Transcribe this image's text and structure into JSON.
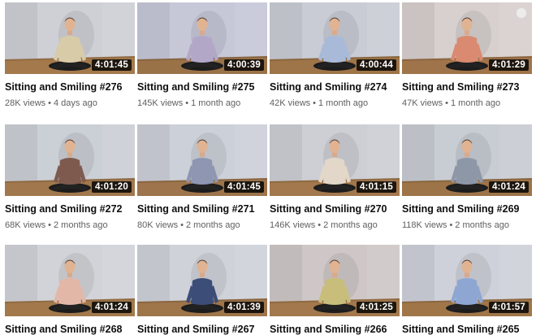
{
  "videos": [
    {
      "title": "Sitting and Smiling #276",
      "views": "28K views",
      "age": "4 days ago",
      "duration": "4:01:45",
      "shirt": "#d8cba8",
      "bg": "#cfd0d6",
      "floor": "#a47a4c"
    },
    {
      "title": "Sitting and Smiling #275",
      "views": "145K views",
      "age": "1 month ago",
      "duration": "4:00:39",
      "shirt": "#b3a7c8",
      "bg": "#c6c8d8",
      "floor": "#9a7248"
    },
    {
      "title": "Sitting and Smiling #274",
      "views": "42K views",
      "age": "1 month ago",
      "duration": "4:00:44",
      "shirt": "#a9bad8",
      "bg": "#c9ccd4",
      "floor": "#9e7548"
    },
    {
      "title": "Sitting and Smiling #273",
      "views": "47K views",
      "age": "1 month ago",
      "duration": "4:01:29",
      "shirt": "#d98a70",
      "bg": "#d7d0cf",
      "floor": "#a0744a"
    },
    {
      "title": "Sitting and Smiling #272",
      "views": "68K views",
      "age": "2 months ago",
      "duration": "4:01:20",
      "shirt": "#7e5a4e",
      "bg": "#cbcfd6",
      "floor": "#a1784d"
    },
    {
      "title": "Sitting and Smiling #271",
      "views": "80K views",
      "age": "2 months ago",
      "duration": "4:01:45",
      "shirt": "#8e96b2",
      "bg": "#ccd0d8",
      "floor": "#9d744b"
    },
    {
      "title": "Sitting and Smiling #270",
      "views": "146K views",
      "age": "2 months ago",
      "duration": "4:01:15",
      "shirt": "#e2d7c8",
      "bg": "#cdcfd5",
      "floor": "#a2784c"
    },
    {
      "title": "Sitting and Smiling #269",
      "views": "118K views",
      "age": "2 months ago",
      "duration": "4:01:24",
      "shirt": "#8d97a8",
      "bg": "#c8ccd3",
      "floor": "#9d7448"
    },
    {
      "title": "Sitting and Smiling #268",
      "views": "",
      "age": "",
      "duration": "4:01:24",
      "shirt": "#e3b7a8",
      "bg": "#d2d3d8",
      "floor": "#a3794c"
    },
    {
      "title": "Sitting and Smiling #267",
      "views": "",
      "age": "",
      "duration": "4:01:39",
      "shirt": "#3c4d78",
      "bg": "#cfd2d9",
      "floor": "#9f754a"
    },
    {
      "title": "Sitting and Smiling #266",
      "views": "",
      "age": "",
      "duration": "4:01:25",
      "shirt": "#c8bd7a",
      "bg": "#cfc7c7",
      "floor": "#a3784c"
    },
    {
      "title": "Sitting and Smiling #265",
      "views": "",
      "age": "",
      "duration": "4:01:57",
      "shirt": "#8ea6d2",
      "bg": "#cfd1da",
      "floor": "#a07649"
    }
  ],
  "icons": {
    "more": "more-vert-icon",
    "watch_later": "watch-later-icon"
  }
}
